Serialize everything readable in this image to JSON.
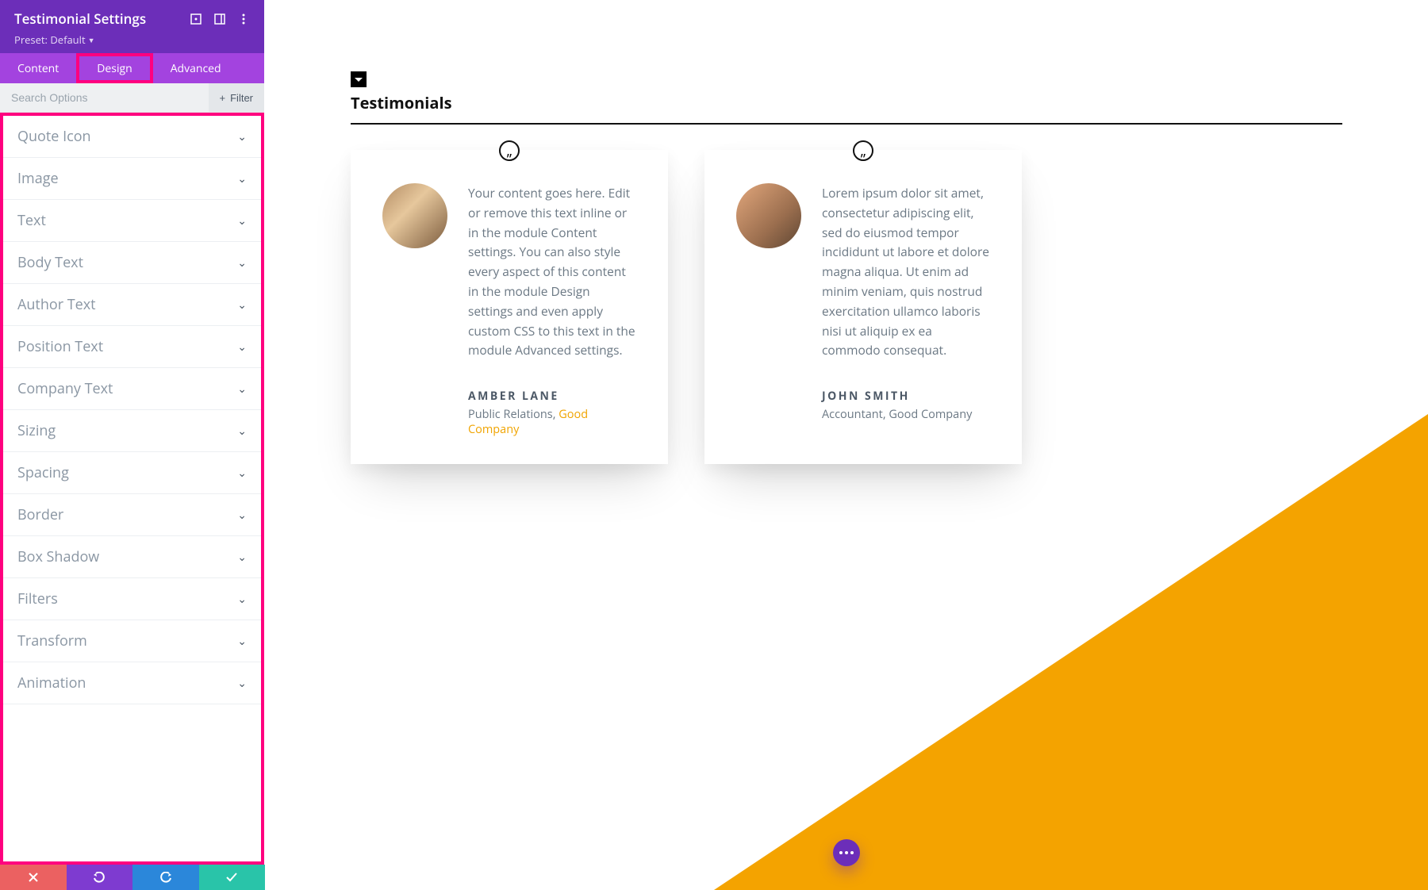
{
  "panel": {
    "title": "Testimonial Settings",
    "preset_label": "Preset: Default",
    "tabs": [
      "Content",
      "Design",
      "Advanced"
    ],
    "active_tab": 1,
    "search_placeholder": "Search Options",
    "filter_label": "Filter"
  },
  "sections": [
    "Quote Icon",
    "Image",
    "Text",
    "Body Text",
    "Author Text",
    "Position Text",
    "Company Text",
    "Sizing",
    "Spacing",
    "Border",
    "Box Shadow",
    "Filters",
    "Transform",
    "Animation"
  ],
  "preview": {
    "section_title": "Testimonials",
    "testimonials": [
      {
        "text": "Your content goes here. Edit or remove this text inline or in the module Content settings. You can also style every aspect of this content in the module Design settings and even apply custom CSS to this text in the module Advanced settings.",
        "author": "AMBER LANE",
        "position": "Public Relations",
        "company": "Good Company",
        "company_is_link": true
      },
      {
        "text": "Lorem ipsum dolor sit amet, consectetur adipiscing elit, sed do eiusmod tempor incididunt ut labore et dolore magna aliqua. Ut enim ad minim veniam, quis nostrud exercitation ullamco laboris nisi ut aliquip ex ea commodo consequat.",
        "author": "JOHN SMITH",
        "position": "Accountant",
        "company": "Good Company",
        "company_is_link": false
      }
    ]
  },
  "colors": {
    "purple_dark": "#6c2eb9",
    "purple_light": "#a343df",
    "accent_pink": "#ff007f",
    "orange": "#f4a300",
    "link_orange": "#f0a400"
  }
}
